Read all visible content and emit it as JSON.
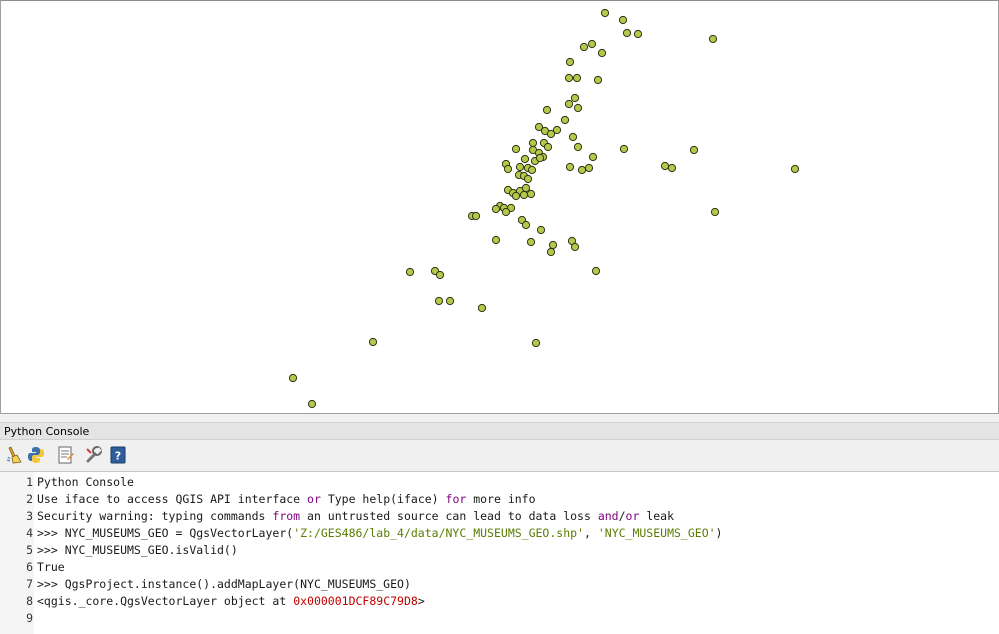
{
  "map": {
    "point_fill": "#b5c84a",
    "point_stroke": "#2e3416",
    "background": "#ffffff"
  },
  "console": {
    "title": "Python Console",
    "toolbar": {
      "clear": "clear-console-icon",
      "run": "python-run-icon",
      "editor": "show-editor-icon",
      "options": "options-wrench-icon",
      "help": "help-icon"
    },
    "lines": [
      {
        "n": "1",
        "text": "Python Console"
      },
      {
        "n": "2",
        "text": "Use iface to access QGIS API interface or Type help(iface) for more info"
      },
      {
        "n": "3",
        "text": "Security warning: typing commands from an untrusted source can lead to data loss and/or leak"
      },
      {
        "n": "4",
        "text": ">>> NYC_MUSEUMS_GEO = QgsVectorLayer('Z:/GES486/lab_4/data/NYC_MUSEUMS_GEO.shp', 'NYC_MUSEUMS_GEO')"
      },
      {
        "n": "5",
        "text": ">>> NYC_MUSEUMS_GEO.isValid()"
      },
      {
        "n": "6",
        "text": "True"
      },
      {
        "n": "7",
        "text": ">>> QgsProject.instance().addMapLayer(NYC_MUSEUMS_GEO)"
      },
      {
        "n": "8",
        "text": "<qgis._core.QgsVectorLayer object at 0x000001DCF89C79D8>"
      },
      {
        "n": "9",
        "text": ""
      }
    ],
    "syntax_colors": {
      "keyword": "#7f007f",
      "string": "#5a7d00",
      "number": "#c00000"
    }
  }
}
